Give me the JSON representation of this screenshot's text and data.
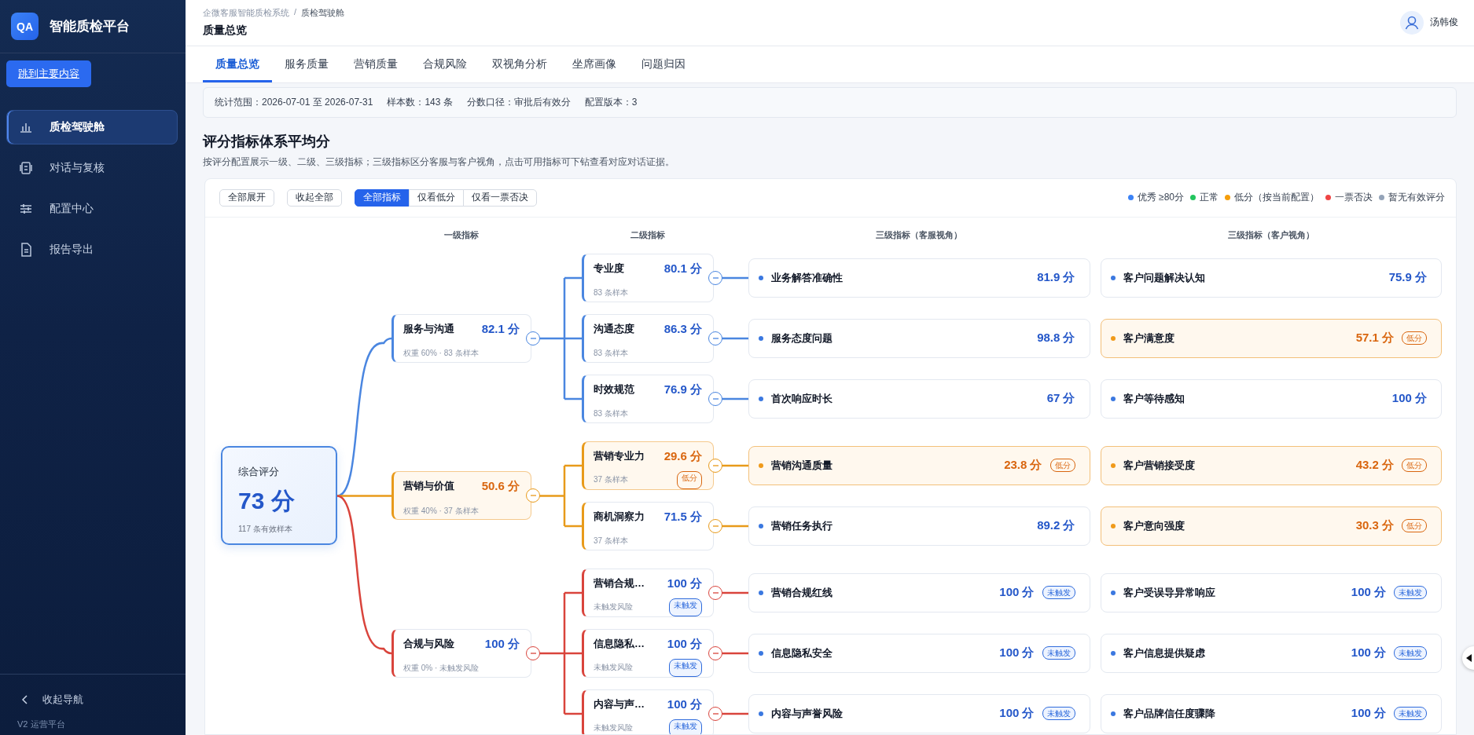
{
  "sidebar": {
    "brand_badge": "QA",
    "brand": "智能质检平台",
    "skip_link": "跳到主要内容",
    "items": [
      {
        "label": "质检驾驶舱",
        "kind": "chart",
        "selected": true
      },
      {
        "label": "对话与复核",
        "kind": "chat",
        "selected": false
      },
      {
        "label": "配置中心",
        "kind": "sliders",
        "selected": false
      },
      {
        "label": "报告导出",
        "kind": "file",
        "selected": false
      }
    ],
    "collapse": "收起导航",
    "version": "V2 运营平台"
  },
  "header": {
    "breadcrumb": [
      "企微客服智能质检系统",
      "质检驾驶舱"
    ],
    "separator": "/",
    "title": "质量总览",
    "user": "汤韩俊"
  },
  "tabs": [
    {
      "label": "质量总览",
      "selected": true
    },
    {
      "label": "服务质量",
      "selected": false
    },
    {
      "label": "营销质量",
      "selected": false
    },
    {
      "label": "合规风险",
      "selected": false
    },
    {
      "label": "双视角分析",
      "selected": false
    },
    {
      "label": "坐席画像",
      "selected": false
    },
    {
      "label": "问题归因",
      "selected": false
    }
  ],
  "info_bar": [
    "统计范围：2026-07-01 至 2026-07-31",
    "样本数：143 条",
    "分数口径：审批后有效分",
    "配置版本：3"
  ],
  "section": {
    "title": "评分指标体系平均分",
    "subtitle": "按评分配置展示一级、二级、三级指标；三级指标区分客服与客户视角，点击可用指标可下钻查看对应对话证据。"
  },
  "toolbar": {
    "buttons": [
      "全部展开",
      "收起全部"
    ],
    "filters": [
      {
        "label": "全部指标",
        "selected": true
      },
      {
        "label": "仅看低分",
        "selected": false
      },
      {
        "label": "仅看一票否决",
        "selected": false
      }
    ]
  },
  "legend": [
    {
      "label": "优秀 ≥80分",
      "color": "#3b82f6"
    },
    {
      "label": "正常",
      "color": "#22c55e"
    },
    {
      "label": "低分（按当前配置）",
      "color": "#f59e0b"
    },
    {
      "label": "一票否决",
      "color": "#ef4444"
    },
    {
      "label": "暂无有效评分",
      "color": "#94a3b8"
    }
  ],
  "tree": {
    "columns": [
      "一级指标",
      "二级指标",
      "三级指标（客服视角）",
      "三级指标（客户视角）"
    ],
    "root": {
      "label": "综合评分",
      "score": "73 分",
      "note": "117 条有效样本"
    },
    "groups": [
      {
        "name": "服务与沟通",
        "score": "82.1 分",
        "meta": "权重 60% · 83 条样本",
        "kind": "normal",
        "color": "#4a86e0",
        "expanded": true,
        "children": [
          {
            "name": "专业度",
            "score": "80.1 分",
            "meta": "83 条样本",
            "kind": "normal",
            "expanded": true,
            "agent": {
              "name": "业务解答准确性",
              "score": "81.9 分",
              "kind": "normal"
            },
            "customer": {
              "name": "客户问题解决认知",
              "score": "75.9 分",
              "kind": "normal"
            }
          },
          {
            "name": "沟通态度",
            "score": "86.3 分",
            "meta": "83 条样本",
            "kind": "normal",
            "expanded": true,
            "agent": {
              "name": "服务态度问题",
              "score": "98.8 分",
              "kind": "normal"
            },
            "customer": {
              "name": "客户满意度",
              "score": "57.1 分",
              "kind": "low",
              "badge": "低分"
            }
          },
          {
            "name": "时效规范",
            "score": "76.9 分",
            "meta": "83 条样本",
            "kind": "normal",
            "expanded": true,
            "agent": {
              "name": "首次响应时长",
              "score": "67 分",
              "kind": "normal"
            },
            "customer": {
              "name": "客户等待感知",
              "score": "100 分",
              "kind": "normal"
            }
          }
        ]
      },
      {
        "name": "营销与价值",
        "score": "50.6 分",
        "meta": "权重 40% · 37 条样本",
        "kind": "low",
        "color": "#e89a1a",
        "expanded": true,
        "children": [
          {
            "name": "营销专业力",
            "score": "29.6 分",
            "meta": "37 条样本",
            "kind": "low",
            "badge": "低分",
            "expanded": true,
            "agent": {
              "name": "营销沟通质量",
              "score": "23.8 分",
              "kind": "low",
              "badge": "低分"
            },
            "customer": {
              "name": "客户营销接受度",
              "score": "43.2 分",
              "kind": "low",
              "badge": "低分"
            }
          },
          {
            "name": "商机洞察力",
            "score": "71.5 分",
            "meta": "37 条样本",
            "kind": "normal",
            "expanded": true,
            "agent": {
              "name": "营销任务执行",
              "score": "89.2 分",
              "kind": "normal"
            },
            "customer": {
              "name": "客户意向强度",
              "score": "30.3 分",
              "kind": "low",
              "badge": "低分"
            }
          }
        ]
      },
      {
        "name": "合规与风险",
        "score": "100 分",
        "meta": "权重 0% · 未触发风险",
        "kind": "normal",
        "color": "#d9443c",
        "expanded": true,
        "children": [
          {
            "name": "营销合规…",
            "score": "100 分",
            "meta": "未触发风险",
            "kind": "normal",
            "badge": "未触发",
            "expanded": true,
            "agent": {
              "name": "营销合规红线",
              "score": "100 分",
              "kind": "normal",
              "badge": "未触发"
            },
            "customer": {
              "name": "客户受误导异常响应",
              "score": "100 分",
              "kind": "normal",
              "badge": "未触发"
            }
          },
          {
            "name": "信息隐私…",
            "score": "100 分",
            "meta": "未触发风险",
            "kind": "normal",
            "badge": "未触发",
            "expanded": true,
            "agent": {
              "name": "信息隐私安全",
              "score": "100 分",
              "kind": "normal",
              "badge": "未触发"
            },
            "customer": {
              "name": "客户信息提供疑虑",
              "score": "100 分",
              "kind": "normal",
              "badge": "未触发"
            }
          },
          {
            "name": "内容与声…",
            "score": "100 分",
            "meta": "未触发风险",
            "kind": "normal",
            "badge": "未触发",
            "expanded": true,
            "agent": {
              "name": "内容与声誉风险",
              "score": "100 分",
              "kind": "normal",
              "badge": "未触发"
            },
            "customer": {
              "name": "客户品牌信任度骤降",
              "score": "100 分",
              "kind": "normal",
              "badge": "未触发"
            }
          }
        ]
      }
    ]
  }
}
